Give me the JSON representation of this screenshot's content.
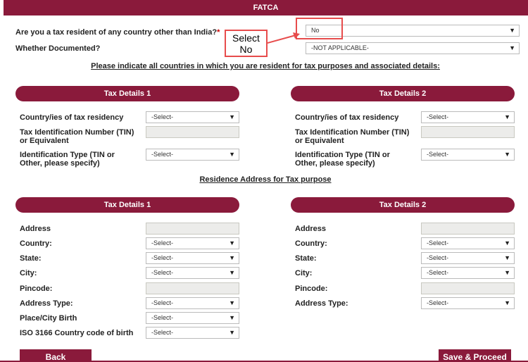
{
  "header": {
    "title": "FATCA"
  },
  "questions": {
    "tax_resident_label": "Are you a tax resident of any country other than India?",
    "tax_resident_required": "*",
    "tax_resident_value": "No",
    "documented_label": "Whether Documented?",
    "documented_value": "-NOT APPLICABLE-"
  },
  "annotation": {
    "line1": "Select",
    "line2": "No",
    "color": "#e74c4c"
  },
  "links": {
    "indicate_countries": "Please indicate all countries in which you are resident for tax purposes and associated details:",
    "residence_address": "Residence Address for Tax purpose"
  },
  "tax_sections": {
    "left_title": "Tax Details 1",
    "right_title": "Tax Details 2",
    "country_label": "Country/ies of tax residency",
    "tin_label_1": "Tax Identification Number (TIN)",
    "tin_label_2": "or Equivalent",
    "id_type_label_1": "Identification Type (TIN or",
    "id_type_label_2": "Other, please specify)",
    "select_placeholder": "-Select-"
  },
  "address_sections": {
    "left_title": "Tax Details 1",
    "right_title": "Tax Details 2",
    "address_label": "Address",
    "country_label": "Country:",
    "state_label": "State:",
    "city_label": "City:",
    "pincode_label": "Pincode:",
    "address_type_label": "Address Type:",
    "place_birth_label": "Place/City Birth",
    "iso_label": "ISO 3166 Country code of birth",
    "select_placeholder": "-Select-"
  },
  "buttons": {
    "back": "Back",
    "save": "Save & Proceed"
  },
  "colors": {
    "brand": "#8a1a3b",
    "field_bg": "#ececea"
  },
  "icons": {
    "dropdown": "chevron-down-icon",
    "arrow": "arrow-right-icon"
  }
}
